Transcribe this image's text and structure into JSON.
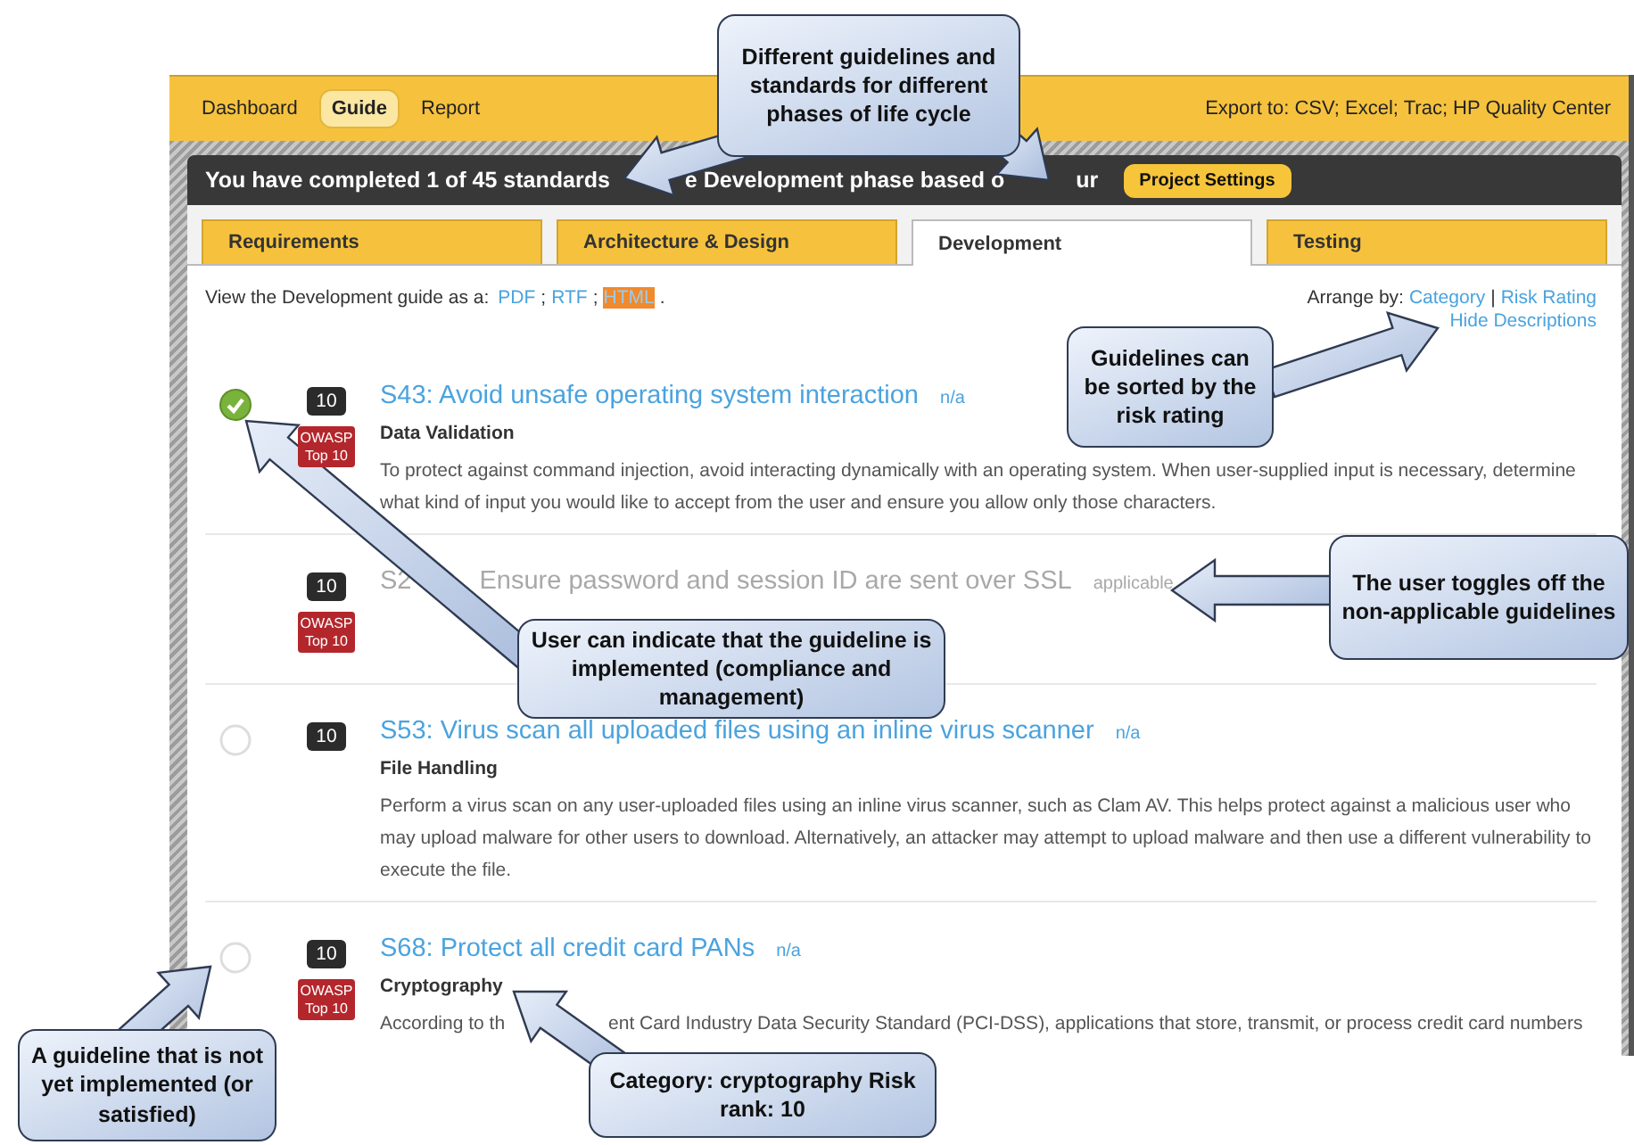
{
  "nav": {
    "items": [
      {
        "label": "Dashboard",
        "selected": false
      },
      {
        "label": "Guide",
        "selected": true
      },
      {
        "label": "Report",
        "selected": false
      }
    ],
    "export": "Export to: CSV; Excel; Trac; HP Quality Center"
  },
  "banner": {
    "text_parts": [
      "You have completed 1 of 45 standards",
      "e Development phase based o",
      "ur"
    ],
    "button": "Project Settings"
  },
  "tabs": [
    {
      "label": "Requirements",
      "selected": false
    },
    {
      "label": "Architecture & Design",
      "selected": false
    },
    {
      "label": "Development",
      "selected": true
    },
    {
      "label": "Testing",
      "selected": false
    }
  ],
  "view_bar": {
    "prefix": "View the Development guide as a:",
    "formats": [
      {
        "label": "PDF",
        "suffix": ";",
        "selected": false
      },
      {
        "label": "RTF",
        "suffix": ";",
        "selected": false
      },
      {
        "label": "HTML",
        "suffix": ".",
        "selected": true
      }
    ],
    "arrange_label": "Arrange by:",
    "arrange_options": [
      "Category",
      "Risk Rating"
    ],
    "arrange_separator": "|",
    "hide_descriptions": "Hide Descriptions"
  },
  "guidelines": [
    {
      "title_parts": [
        "S43: Avoid unsafe operating system interaction"
      ],
      "status": "n/a",
      "applicable": true,
      "implemented": true,
      "risk": "10",
      "owasp": "OWASP Top 10",
      "category": "Data Validation",
      "description_parts": [
        "To protect against command injection, avoid interacting dynamically with an operating system. When user-supplied input is necessary, determine what kind of input you would like to accept from the user and ensure you allow only those characters."
      ]
    },
    {
      "title_parts": [
        "S2",
        "Ensure password and session ID are sent over SSL"
      ],
      "status": "applicable",
      "applicable": false,
      "risk": "10",
      "owasp": "OWASP Top 10"
    },
    {
      "title_parts": [
        "S53: Virus scan all uploaded files using an inline virus scanner"
      ],
      "status": "n/a",
      "applicable": true,
      "implemented": false,
      "risk": "10",
      "category": "File Handling",
      "description_parts": [
        "Perform a virus scan on any user-uploaded files using an inline virus scanner, such as Clam AV. This helps protect against a malicious user who may upload malware for other users to download. Alternatively, an attacker may attempt to upload malware and then use a different vulnerability to execute the file."
      ]
    },
    {
      "title_parts": [
        "S68: Protect all credit card PANs"
      ],
      "status": "n/a",
      "applicable": true,
      "implemented": false,
      "risk": "10",
      "owasp": "OWASP Top 10",
      "category": "Cryptography",
      "description_parts": [
        "According to th",
        "ent Card Industry Data Security Standard (PCI-DSS), applications that store, transmit, or process credit card numbers"
      ]
    }
  ],
  "callouts": [
    {
      "text": "Different guidelines and standards for different phases of life cycle"
    },
    {
      "text": "Guidelines can be sorted by the risk rating"
    },
    {
      "text": "The user toggles off the non-applicable guidelines"
    },
    {
      "text": "User can indicate that the guideline is implemented (compliance and management)"
    },
    {
      "text": "A guideline that is not yet implemented (or satisfied)"
    },
    {
      "text": "Category: cryptography Risk rank: 10"
    }
  ]
}
